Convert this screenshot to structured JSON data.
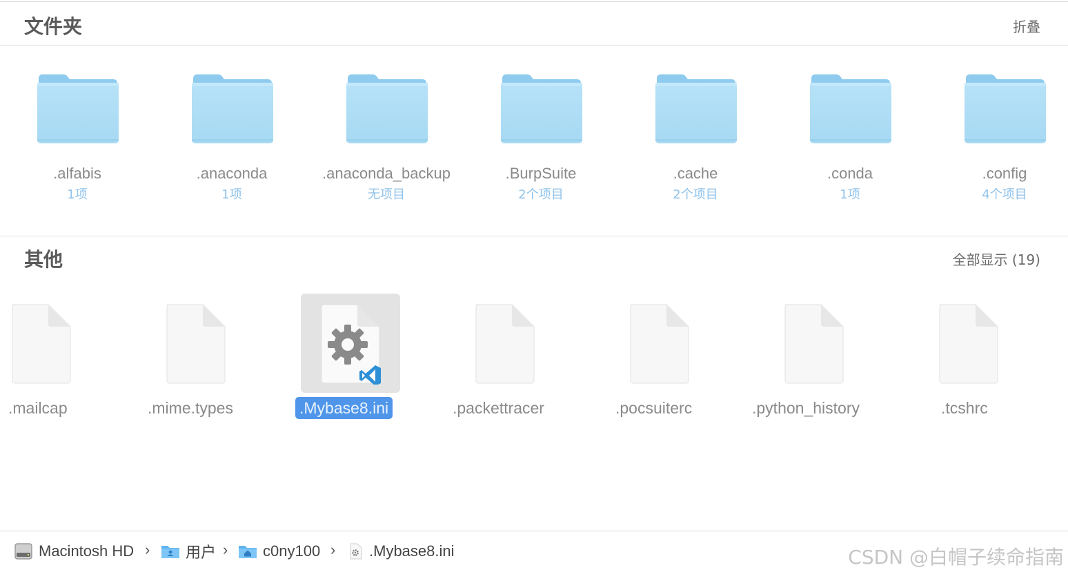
{
  "folders_section": {
    "title": "文件夹",
    "action": "折叠",
    "items": [
      {
        "name": ".alfabis",
        "count": "1项"
      },
      {
        "name": ".anaconda",
        "count": "1项"
      },
      {
        "name": ".anaconda_backup",
        "count": "无项目"
      },
      {
        "name": ".BurpSuite",
        "count": "2个项目"
      },
      {
        "name": ".cache",
        "count": "2个项目"
      },
      {
        "name": ".conda",
        "count": "1项"
      },
      {
        "name": ".config",
        "count": "4个项目"
      }
    ]
  },
  "others_section": {
    "title": "其他",
    "action": "全部显示 (19)",
    "items": [
      {
        "name": ".mailcap",
        "selected": false
      },
      {
        "name": ".mime.types",
        "selected": false
      },
      {
        "name": ".Mybase8.ini",
        "selected": true
      },
      {
        "name": ".packettracer",
        "selected": false
      },
      {
        "name": ".pocsuiterc",
        "selected": false
      },
      {
        "name": ".python_history",
        "selected": false
      },
      {
        "name": ".tcshrc",
        "selected": false
      }
    ]
  },
  "path_bar": {
    "crumbs": [
      {
        "label": "Macintosh HD",
        "icon": "hard-drive-icon"
      },
      {
        "label": "用户",
        "icon": "users-folder-icon"
      },
      {
        "label": "c0ny100",
        "icon": "home-folder-icon"
      },
      {
        "label": ".Mybase8.ini",
        "icon": "settings-file-icon"
      }
    ],
    "separator": "›"
  },
  "watermark": "CSDN @白帽子续命指南",
  "colors": {
    "folder_blue": "#a9dbf5",
    "folder_tab": "#8fcaee",
    "selection_blue": "#4f96ea",
    "count_blue": "#8fc2ea"
  }
}
